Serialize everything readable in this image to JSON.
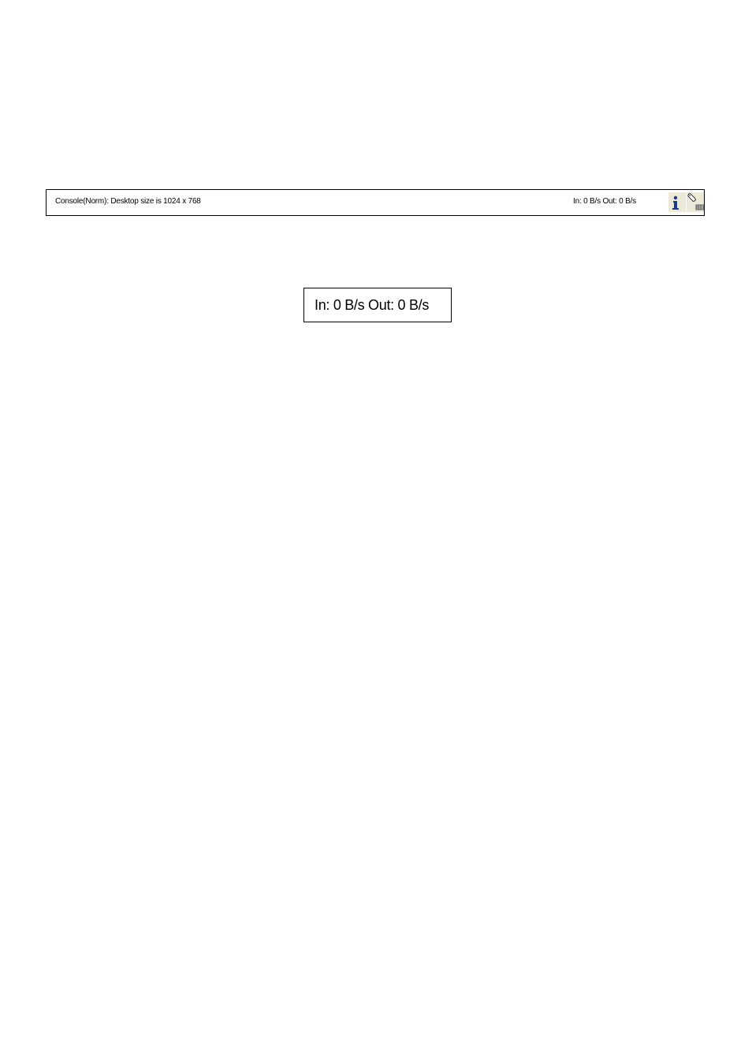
{
  "status_bar": {
    "message": "Console(Norm): Desktop size is 1024 x 768",
    "throughput": "In: 0 B/s Out: 0 B/s",
    "icons": [
      "info-icon",
      "mouse-keyboard-icon"
    ]
  },
  "callout": {
    "throughput": "In: 0 B/s Out: 0 B/s"
  },
  "colors": {
    "border": "#000000",
    "icon_background": "#ece9d8",
    "info_icon": "#1a3b8a"
  }
}
